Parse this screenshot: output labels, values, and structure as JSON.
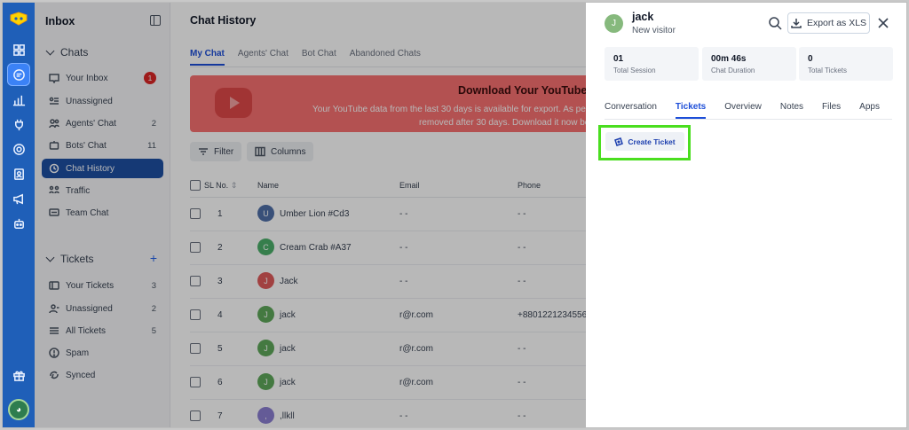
{
  "sidebar": {
    "header": "Inbox",
    "chats_section": "Chats",
    "chat_items": [
      {
        "label": "Your Inbox",
        "badge": "1"
      },
      {
        "label": "Unassigned",
        "count": ""
      },
      {
        "label": "Agents' Chat",
        "count": "2"
      },
      {
        "label": "Bots' Chat",
        "count": "11"
      },
      {
        "label": "Chat History",
        "count": ""
      },
      {
        "label": "Traffic",
        "count": ""
      },
      {
        "label": "Team Chat",
        "count": ""
      }
    ],
    "tickets_section": "Tickets",
    "tickets_add": "+",
    "ticket_items": [
      {
        "label": "Your Tickets",
        "count": "3"
      },
      {
        "label": "Unassigned",
        "count": "2"
      },
      {
        "label": "All Tickets",
        "count": "5"
      },
      {
        "label": "Spam",
        "count": ""
      },
      {
        "label": "Synced",
        "count": ""
      }
    ]
  },
  "main": {
    "title": "Chat History",
    "tabs": [
      "My Chat",
      "Agents' Chat",
      "Bot Chat",
      "Abandoned Chats"
    ],
    "banner": {
      "title": "Download Your YouTube",
      "line1": "Your YouTube data from the last 30 days is available for export. As per",
      "line2": "removed after 30 days. Download it now be"
    },
    "filter_label": "Filter",
    "columns_label": "Columns",
    "table": {
      "headers": {
        "sl": "SL No.",
        "name": "Name",
        "email": "Email",
        "phone": "Phone"
      },
      "rows": [
        {
          "sl": "1",
          "initial": "U",
          "name": "Umber Lion #Cd3",
          "email": "- -",
          "phone": "- -",
          "color": "#4f6fa8"
        },
        {
          "sl": "2",
          "initial": "C",
          "name": "Cream Crab #A37",
          "email": "- -",
          "phone": "- -",
          "color": "#4caf6a"
        },
        {
          "sl": "3",
          "initial": "J",
          "name": "Jack",
          "email": "- -",
          "phone": "- -",
          "color": "#e05a5a"
        },
        {
          "sl": "4",
          "initial": "J",
          "name": "jack",
          "email": "r@r.com",
          "phone": "+8801221234556",
          "color": "#5fa85a"
        },
        {
          "sl": "5",
          "initial": "J",
          "name": "jack",
          "email": "r@r.com",
          "phone": "- -",
          "color": "#5fa85a"
        },
        {
          "sl": "6",
          "initial": "J",
          "name": "jack",
          "email": "r@r.com",
          "phone": "- -",
          "color": "#5fa85a"
        },
        {
          "sl": "7",
          "initial": ",",
          "name": ",llkll",
          "email": "- -",
          "phone": "- -",
          "color": "#8b7fd1"
        }
      ]
    }
  },
  "drawer": {
    "visitor_initial": "J",
    "visitor_name": "jack",
    "visitor_status": "New visitor",
    "export_label": "Export as XLS",
    "stats": [
      {
        "value": "01",
        "label": "Total Session"
      },
      {
        "value": "00m 46s",
        "label": "Chat Duration"
      },
      {
        "value": "0",
        "label": "Total Tickets"
      }
    ],
    "tabs": [
      "Conversation",
      "Tickets",
      "Overview",
      "Notes",
      "Files",
      "Apps"
    ],
    "active_tab": "Tickets",
    "create_ticket_label": "Create Ticket"
  },
  "colors": {
    "rail": "#1f5fb8",
    "accent": "#1d4ed8",
    "highlight": "#4ade1f",
    "banner": "#f87171"
  }
}
